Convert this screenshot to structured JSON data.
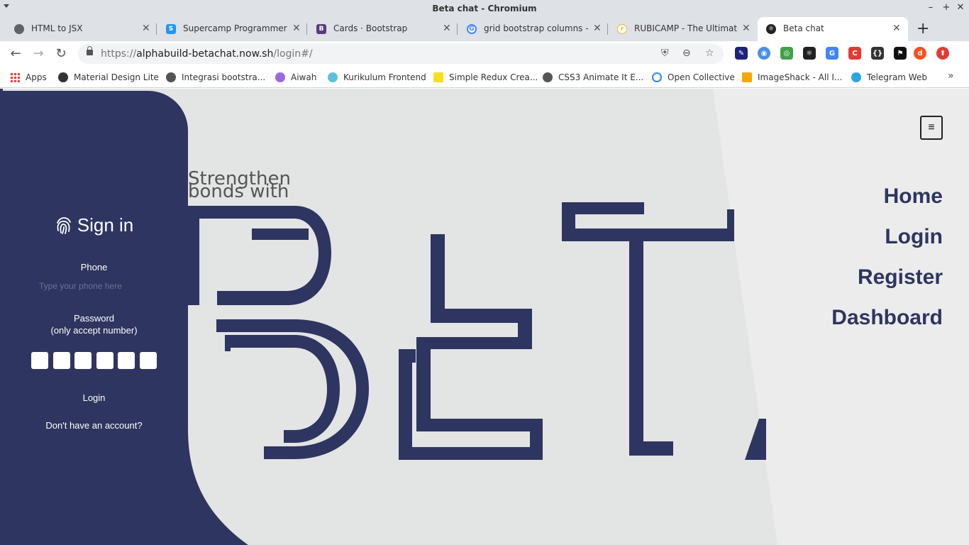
{
  "window": {
    "title": "Beta chat - Chromium"
  },
  "tabs": [
    {
      "label": "HTML to JSX",
      "icon": "globe-icon",
      "color": "#5f6368"
    },
    {
      "label": "Supercamp Programmer",
      "icon": "supercamp-icon",
      "color": "#2196f3"
    },
    {
      "label": "Cards · Bootstrap",
      "icon": "bootstrap-icon",
      "color": "#563d7c"
    },
    {
      "label": "grid bootstrap columns - P",
      "icon": "google-icon",
      "color": "#4285f4"
    },
    {
      "label": "RUBICAMP - The Ultimate",
      "icon": "rubicamp-icon",
      "color": "#f0b429"
    },
    {
      "label": "Beta chat",
      "icon": "react-icon",
      "color": "#222222"
    }
  ],
  "address": {
    "scheme": "https://",
    "host": "alphabuild-betachat.now.sh",
    "path": "/login#/"
  },
  "bookmarks": [
    {
      "label": "Apps",
      "icon": "apps-grid-icon",
      "color": "#e53935"
    },
    {
      "label": "Material Design Lite",
      "icon": "mdl-icon",
      "color": "#333333"
    },
    {
      "label": "Integrasi bootstra...",
      "icon": "globe-icon",
      "color": "#555555"
    },
    {
      "label": "Aiwah",
      "icon": "aiwah-icon",
      "color": "#9c6ad8"
    },
    {
      "label": "Kurikulum Frontend",
      "icon": "gear-icon",
      "color": "#5bc0de"
    },
    {
      "label": "Simple Redux Crea...",
      "icon": "redux-icon",
      "color": "#f7df1e"
    },
    {
      "label": "CSS3 Animate It E...",
      "icon": "globe-icon",
      "color": "#555555"
    },
    {
      "label": "Open Collective",
      "icon": "opencollective-icon",
      "color": "#3385ff"
    },
    {
      "label": "ImageShack - All I...",
      "icon": "imageshack-icon",
      "color": "#f2a900"
    },
    {
      "label": "Telegram Web",
      "icon": "telegram-icon",
      "color": "#2ca5e0"
    }
  ],
  "extensions": [
    {
      "icon": "eyedropper-icon",
      "color": "#1a237e"
    },
    {
      "icon": "privacy-icon",
      "color": "#4a90e2"
    },
    {
      "icon": "colorwheel-icon",
      "color": "#43a047"
    },
    {
      "icon": "react-devtools-icon",
      "color": "#222222"
    },
    {
      "icon": "translate-icon",
      "color": "#4285f4"
    },
    {
      "icon": "c-icon",
      "color": "#e53935"
    },
    {
      "icon": "json-icon",
      "color": "#333333"
    },
    {
      "icon": "flag-icon",
      "color": "#111111"
    },
    {
      "icon": "profile-icon",
      "color": "#f4511e"
    },
    {
      "icon": "upload-icon",
      "color": "#e53935"
    }
  ],
  "login": {
    "title": "Sign in",
    "phone_label": "Phone",
    "phone_placeholder": "Type your phone here",
    "password_label": "Password",
    "password_hint": "(only accept number)",
    "pin_count": 6,
    "login_link": "Login",
    "signup_link": "Don't have an account?"
  },
  "hero": {
    "tagline_line1": "Strengthen",
    "tagline_line2": "bonds with"
  },
  "nav": {
    "menu_icon": "≡",
    "items": [
      "Home",
      "Login",
      "Register",
      "Dashboard"
    ]
  },
  "theme": {
    "primary": "#2e3560",
    "page_bg": "#e3e4e4"
  }
}
